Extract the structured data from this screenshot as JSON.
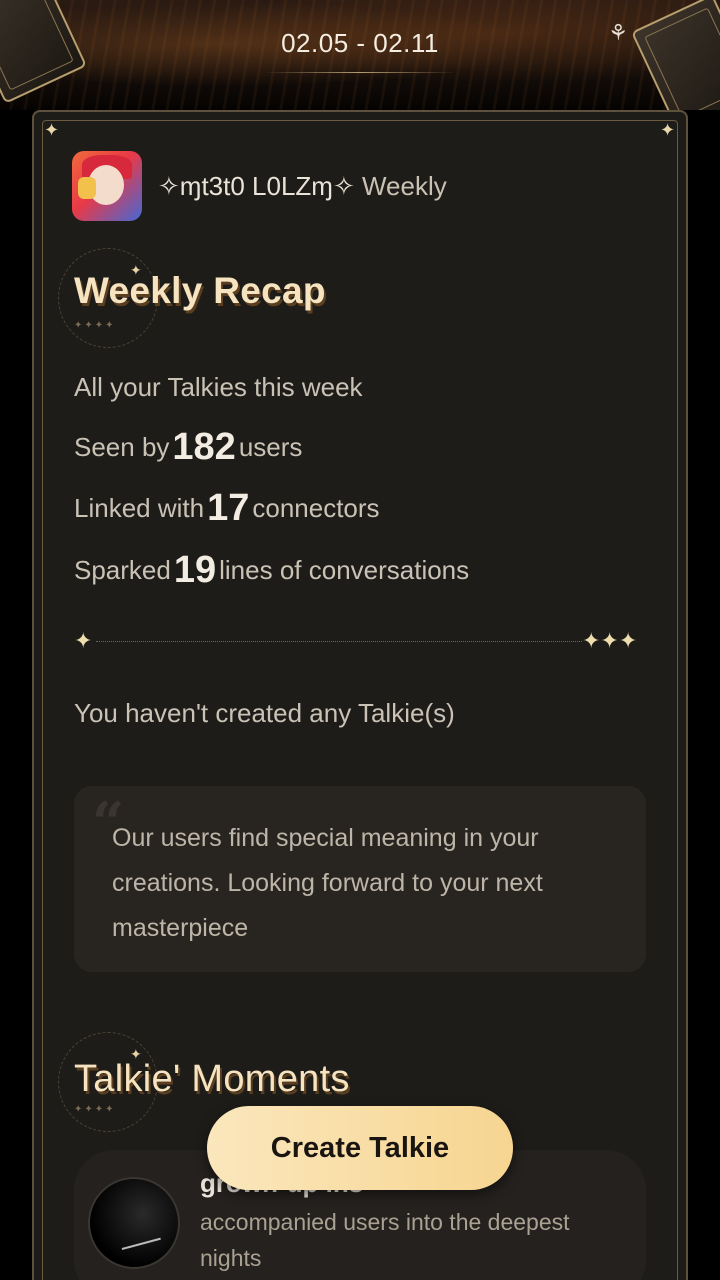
{
  "banner": {
    "date_range": "02.05 - 02.11"
  },
  "header": {
    "username": "✧ɱt3t0 L0LZɱ✧",
    "weekly_label": "Weekly"
  },
  "recap": {
    "title": "Weekly Recap",
    "intro": "All your Talkies this week",
    "seen_prefix": "Seen by",
    "seen_count": "182",
    "seen_suffix": "users",
    "linked_prefix": "Linked with",
    "linked_count": "17",
    "linked_suffix": "connectors",
    "sparked_prefix": "Sparked",
    "sparked_count": "19",
    "sparked_suffix": "lines of conversations"
  },
  "creations": {
    "empty_text": "You haven't created any Talkie(s)",
    "quote": "Our users find special meaning in your creations. Looking forward to your next masterpiece"
  },
  "moments": {
    "title": "Talkie' Moments",
    "items": [
      {
        "name": "grown-up ins",
        "description": "accompanied users into the deepest nights"
      }
    ]
  },
  "actions": {
    "create_label": "Create Talkie"
  },
  "colors": {
    "accent_gold": "#f6d590",
    "background": "#1e1c19"
  }
}
